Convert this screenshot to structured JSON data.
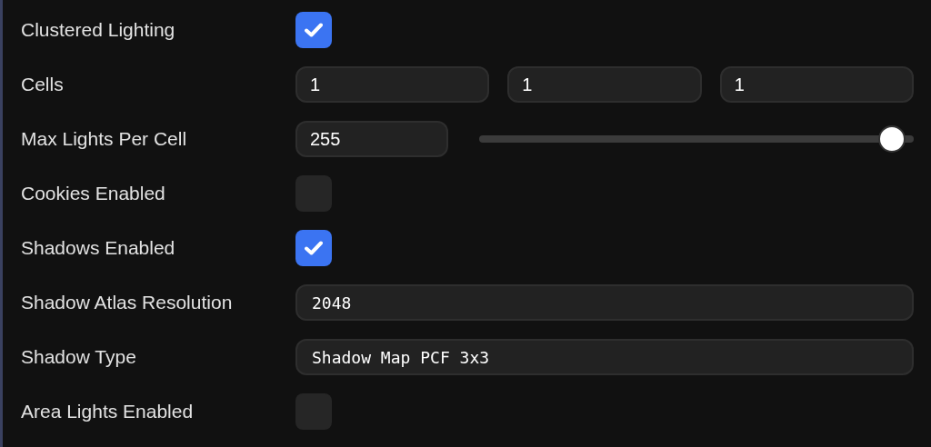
{
  "rows": [
    {
      "kind": "checkbox",
      "label": "Clustered Lighting",
      "checked": true
    },
    {
      "kind": "vector",
      "label": "Cells",
      "values": [
        "1",
        "1",
        "1"
      ]
    },
    {
      "kind": "slider",
      "label": "Max Lights Per Cell",
      "value": "255",
      "level": 1.0
    },
    {
      "kind": "checkbox",
      "label": "Cookies Enabled",
      "checked": false
    },
    {
      "kind": "checkbox",
      "label": "Shadows Enabled",
      "checked": true
    },
    {
      "kind": "mono-field",
      "label": "Shadow Atlas Resolution",
      "value": "2048"
    },
    {
      "kind": "select",
      "label": "Shadow Type",
      "value": "Shadow Map PCF 3x3"
    },
    {
      "kind": "checkbox",
      "label": "Area Lights Enabled",
      "checked": false
    }
  ]
}
